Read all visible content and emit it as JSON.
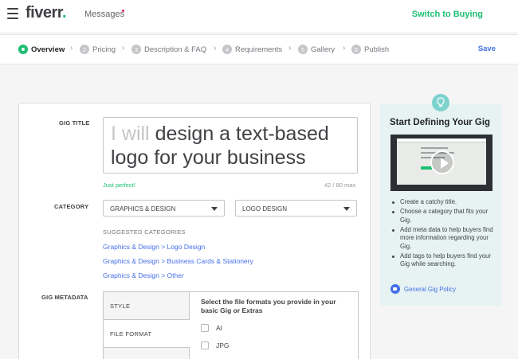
{
  "topbar": {
    "logo": "fiverr",
    "logo_dot": ".",
    "messages_label": "Messages",
    "switch_label": "Switch to Buying"
  },
  "steps": [
    {
      "num": "",
      "label": "Overview",
      "active": true
    },
    {
      "num": "2",
      "label": "Pricing"
    },
    {
      "num": "3",
      "label": "Description & FAQ"
    },
    {
      "num": "4",
      "label": "Requirements"
    },
    {
      "num": "5",
      "label": "Gallery"
    },
    {
      "num": "6",
      "label": "Publish"
    }
  ],
  "save_label": "Save",
  "form": {
    "gig_title_label": "GIG TITLE",
    "title_prefix": "I will",
    "title_text": "design a text-based logo for your business",
    "title_feedback": "Just perfect!",
    "title_count": "42 / 80 max",
    "category_label": "CATEGORY",
    "category_value": "GRAPHICS & DESIGN",
    "subcategory_value": "LOGO DESIGN",
    "suggested_heading": "SUGGESTED CATEGORIES",
    "suggested": [
      "Graphics & Design > Logo Design",
      "Graphics & Design > Business Cards & Stationery",
      "Graphics & Design > Other"
    ],
    "metadata_label": "GIG METADATA",
    "metadata_tabs": [
      "STYLE",
      "FILE FORMAT",
      ""
    ],
    "metadata_question": "Select the file formats you provide in your basic Gig or Extras",
    "formats": [
      "AI",
      "JPG",
      ""
    ]
  },
  "sidebar": {
    "title": "Start Defining Your Gig",
    "video_icon": "play-icon",
    "tips": [
      "Create a catchy title.",
      "Choose a category that fits your Gig.",
      "Add meta data to help buyers find more information regarding your Gig.",
      "Add tags to help buyers find your Gig while searching."
    ],
    "policy_link": "General Gig Policy"
  },
  "colors": {
    "brand_green": "#1dbf73",
    "link_blue": "#446ee7",
    "sidebar_bg": "#e6f3f2"
  }
}
